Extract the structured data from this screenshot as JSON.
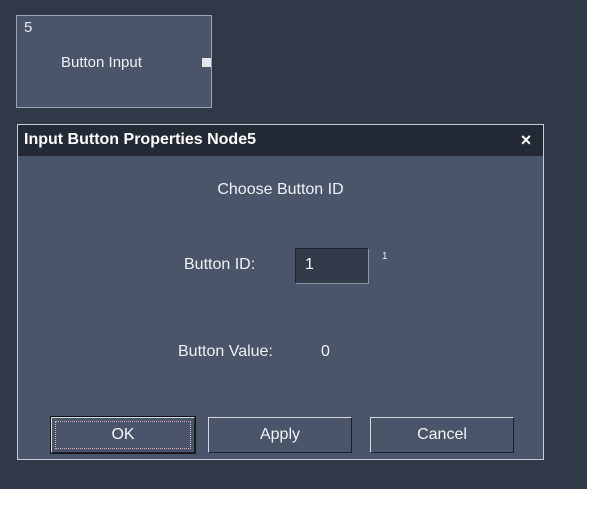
{
  "canvas": {
    "node": {
      "number": "5",
      "title": "Button Input"
    }
  },
  "dialog": {
    "title": "Input Button Properties Node5",
    "close_glyph": "×",
    "heading": "Choose Button ID",
    "button_id_label": "Button ID:",
    "button_id_value": "1",
    "button_id_hint": "1",
    "button_value_label": "Button Value:",
    "button_value": "0",
    "buttons": {
      "ok": "OK",
      "apply": "Apply",
      "cancel": "Cancel"
    }
  }
}
